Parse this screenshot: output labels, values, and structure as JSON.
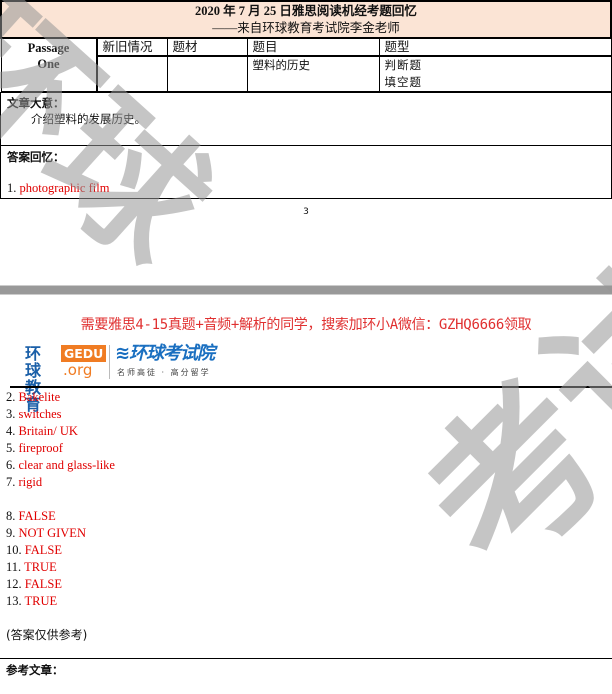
{
  "header": {
    "title": "2020 年 7 月 25 日雅思阅读机经考题回忆",
    "subtitle": "——来自环球教育考试院李金老师"
  },
  "table": {
    "passage_label_1": "Passage",
    "passage_label_2": "One",
    "columns": [
      "新旧情况",
      "题材",
      "题目",
      "题型"
    ],
    "row": {
      "status": "",
      "material": "",
      "topic": "塑料的历史",
      "types": [
        "判断题",
        "填空题"
      ]
    }
  },
  "summary": {
    "label": "文章大意：",
    "text": "介绍塑料的发展历史。"
  },
  "answers_section": {
    "label": "答案回忆：",
    "first": {
      "num": "1.",
      "text": "photographic film"
    }
  },
  "page_number": "3",
  "promo": "需要雅思4-15真题+音频+解析的同学，搜索加环小A微信：GZHQ6666领取",
  "logo": {
    "cn_line1": "环球",
    "cn_line2": "教育",
    "gedu": "GEDU",
    "org": ".org",
    "brand": "≋环球考试院",
    "slogan": "名师高徒 · 高分留学"
  },
  "answers": [
    {
      "num": "2.",
      "text": "Bakelite"
    },
    {
      "num": "3.",
      "text": "switches"
    },
    {
      "num": "4.",
      "text": "Britain/ UK"
    },
    {
      "num": "5.",
      "text": "fireproof"
    },
    {
      "num": "6.",
      "text": "clear and glass-like"
    },
    {
      "num": "7.",
      "text": "rigid"
    },
    {
      "num": "",
      "text": ""
    },
    {
      "num": "8.",
      "text": "FALSE"
    },
    {
      "num": "9.",
      "text": "NOT GIVEN"
    },
    {
      "num": "10.",
      "text": "FALSE"
    },
    {
      "num": "11.",
      "text": "TRUE"
    },
    {
      "num": "12.",
      "text": "FALSE"
    },
    {
      "num": "13.",
      "text": "TRUE"
    }
  ],
  "note": "(答案仅供参考)",
  "reference_label": "参考文章：",
  "watermark": {
    "top": "环球",
    "bottom": "考试院"
  },
  "colors": {
    "answer_red": "#e00000",
    "header_bg": "#fbe4d5",
    "promo_red": "#e03030",
    "logo_blue": "#1a5fa8",
    "logo_orange": "#f07c23"
  }
}
